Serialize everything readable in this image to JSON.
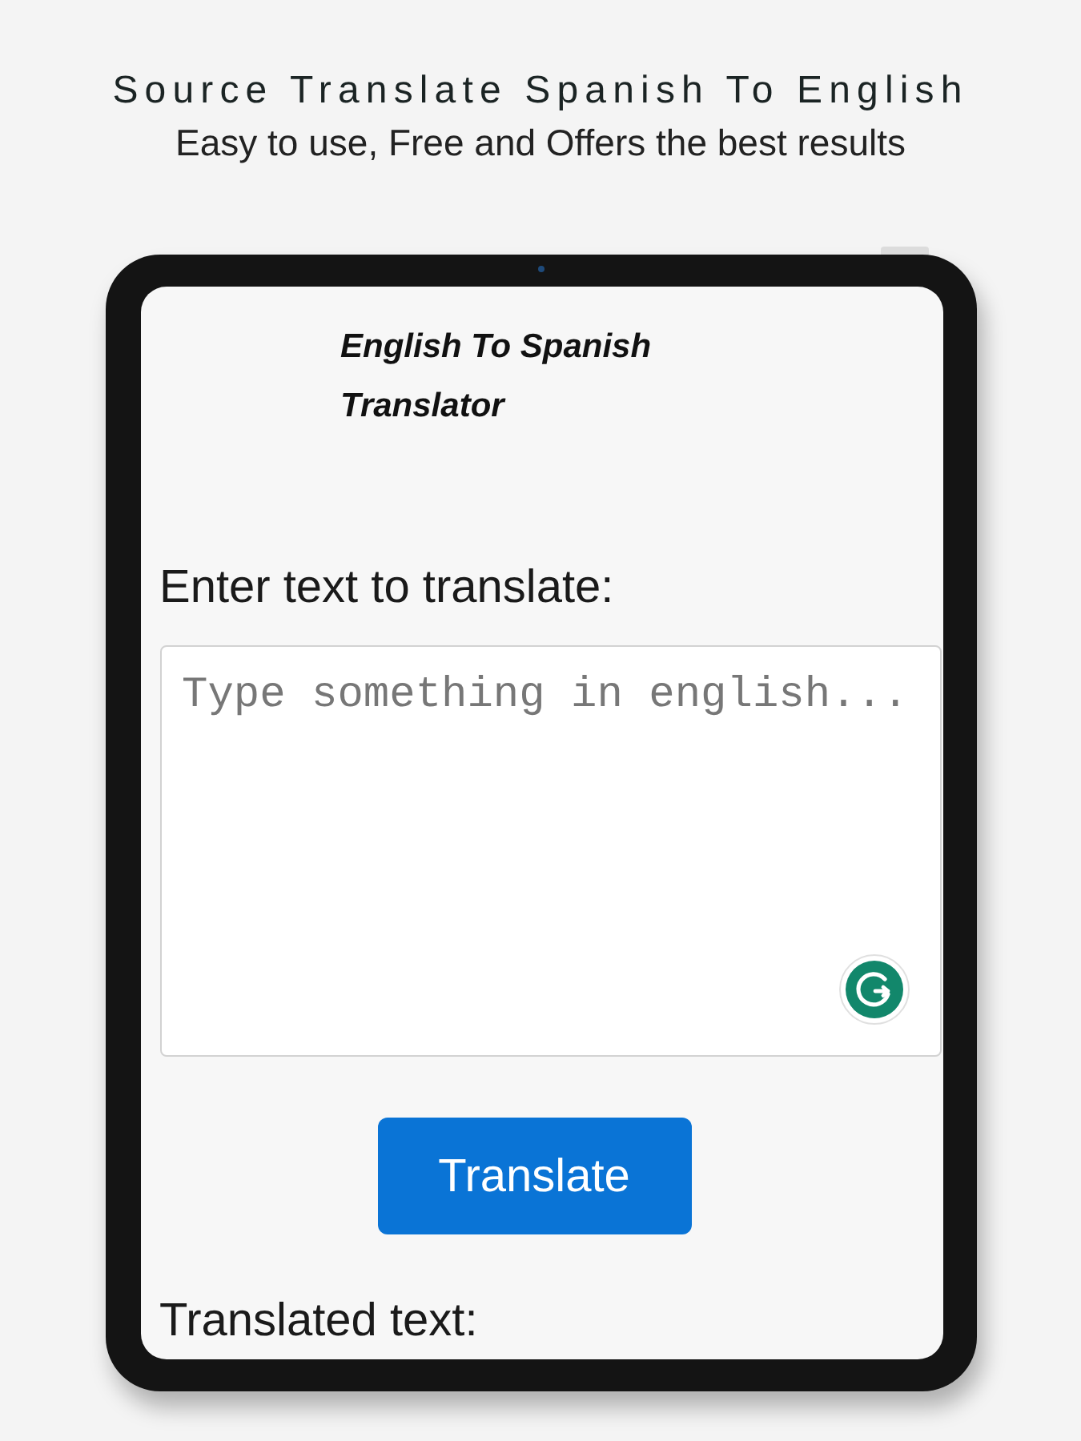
{
  "header": {
    "title": "Source Translate Spanish To English",
    "subtitle": "Easy to use, Free and Offers the best results"
  },
  "translator": {
    "title": "English To Spanish Translator",
    "input_label": "Enter text to translate:",
    "input": {
      "placeholder": "Type something in english..."
    },
    "button": "Translate",
    "output_label": "Translated text:"
  }
}
